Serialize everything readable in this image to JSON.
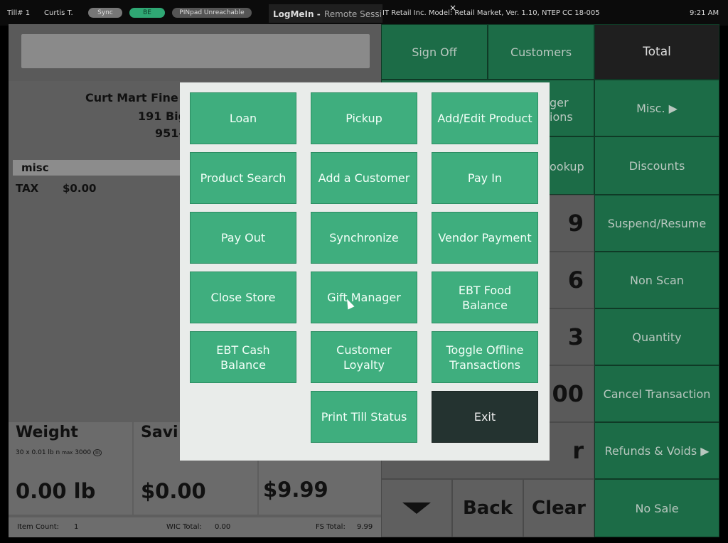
{
  "topbar": {
    "till": "Till# 1",
    "user": "Curtis T.",
    "sync": "Sync",
    "be": "BE",
    "pinpad": "PINpad Unreachable",
    "logmein": "LogMeIn -",
    "remote": "Remote Sessi",
    "close": "×",
    "company": "IT Retail Inc. Model: Retail Market, Ver. 1.10, NTEP CC 18-005",
    "time": "9:21 AM"
  },
  "receipt": {
    "store_name": "Curt Mart Fine F",
    "address": "191 Big",
    "phone": "951-",
    "misc_label": "misc",
    "tax_label": "TAX",
    "tax_value": "$0.00"
  },
  "tiles": {
    "weight_caption": "Weight",
    "weight_small": "30 x 0.01 lb n",
    "weight_max": "3000",
    "weight_value": "0.00 lb",
    "savings_caption": "Savi",
    "savings_value": "$0.00",
    "total_value": "$9.99"
  },
  "footer": {
    "item_count_label": "Item Count:",
    "item_count_value": "1",
    "wic_label": "WIC Total:",
    "wic_value": "0.00",
    "fs_label": "FS Total:",
    "fs_value": "9.99"
  },
  "right_panel": {
    "sign_off": "Sign Off",
    "customers": "Customers",
    "total": "Total",
    "ger_frag": "ger",
    "ions_frag": "ions",
    "misc": "Misc. ▶",
    "lookup_frag": "ookup",
    "discounts": "Discounts",
    "suspend": "Suspend/Resume",
    "non_scan": "Non Scan",
    "quantity": "Quantity",
    "cancel": "Cancel Transaction",
    "refunds": "Refunds & Voids ▶",
    "no_sale": "No Sale",
    "num9": "9",
    "num6": "6",
    "num3": "3",
    "num00": "00",
    "r_frag": "r",
    "back": "Back",
    "clear": "Clear"
  },
  "modal": {
    "buttons": [
      "Loan",
      "Pickup",
      "Add/Edit Product",
      "Product Search",
      "Add a Customer",
      "Pay In",
      "Pay Out",
      "Synchronize",
      "Vendor Payment",
      "Close Store",
      "Gift Manager",
      "EBT Food Balance",
      "EBT Cash Balance",
      "Customer Loyalty",
      "Toggle Offline Transactions",
      "Print Till Status",
      "Exit"
    ]
  },
  "colors": {
    "modal_button": "#3fae7e",
    "exit_button": "#243330",
    "panel_green": "#1c6c47",
    "total_dark": "#1f1f1f"
  }
}
